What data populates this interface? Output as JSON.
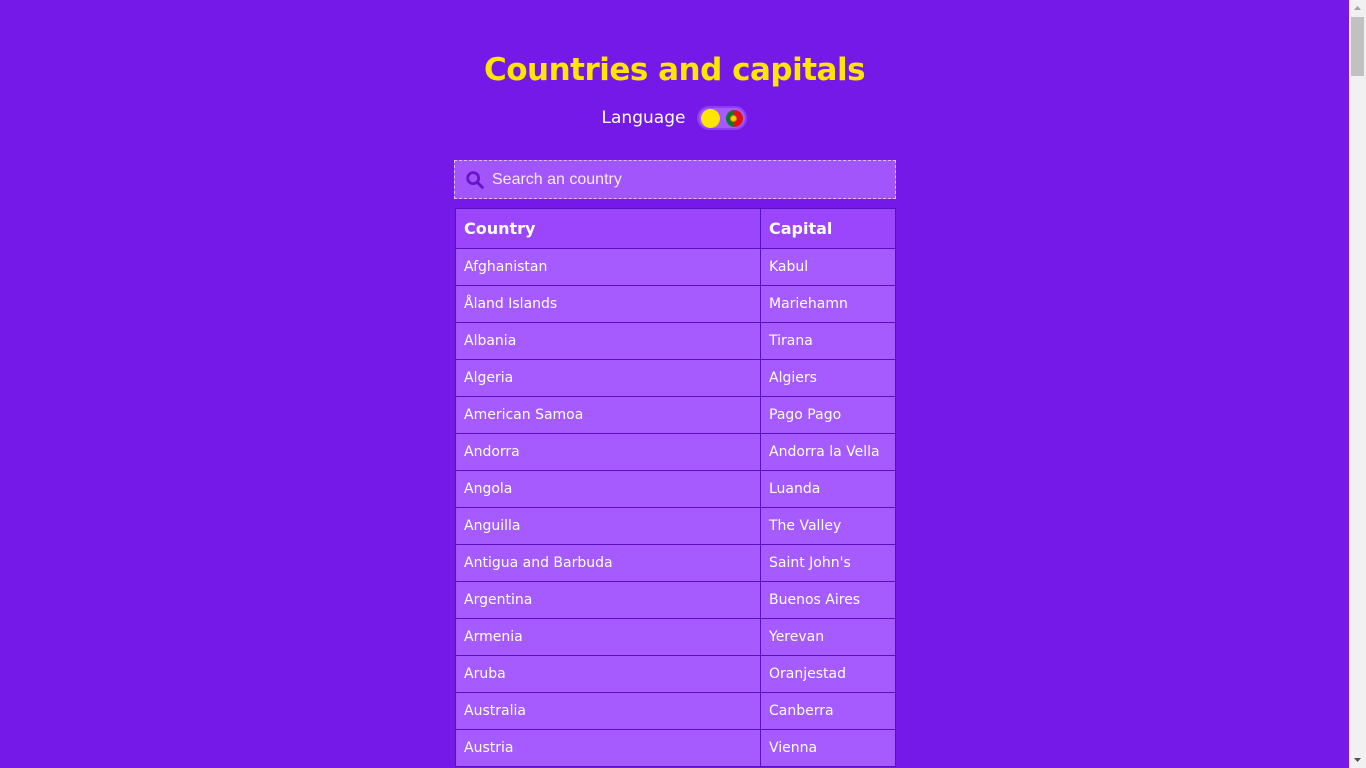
{
  "header": {
    "title": "Countries and capitals",
    "language_label": "Language"
  },
  "colors": {
    "background": "#7419e8",
    "title": "#ffe500",
    "table_cell": "#a55bff",
    "table_header": "#9b46fd"
  },
  "language_toggle": {
    "state": "off",
    "knob_icon": "yellow-circle",
    "flag_icon": "portugal-flag-icon"
  },
  "search": {
    "placeholder": "Search an country",
    "value": ""
  },
  "table": {
    "headers": [
      "Country",
      "Capital"
    ],
    "rows": [
      [
        "Afghanistan",
        "Kabul"
      ],
      [
        "Åland Islands",
        "Mariehamn"
      ],
      [
        "Albania",
        "Tirana"
      ],
      [
        "Algeria",
        "Algiers"
      ],
      [
        "American Samoa",
        "Pago Pago"
      ],
      [
        "Andorra",
        "Andorra la Vella"
      ],
      [
        "Angola",
        "Luanda"
      ],
      [
        "Anguilla",
        "The Valley"
      ],
      [
        "Antigua and Barbuda",
        "Saint John's"
      ],
      [
        "Argentina",
        "Buenos Aires"
      ],
      [
        "Armenia",
        "Yerevan"
      ],
      [
        "Aruba",
        "Oranjestad"
      ],
      [
        "Australia",
        "Canberra"
      ],
      [
        "Austria",
        "Vienna"
      ]
    ]
  }
}
